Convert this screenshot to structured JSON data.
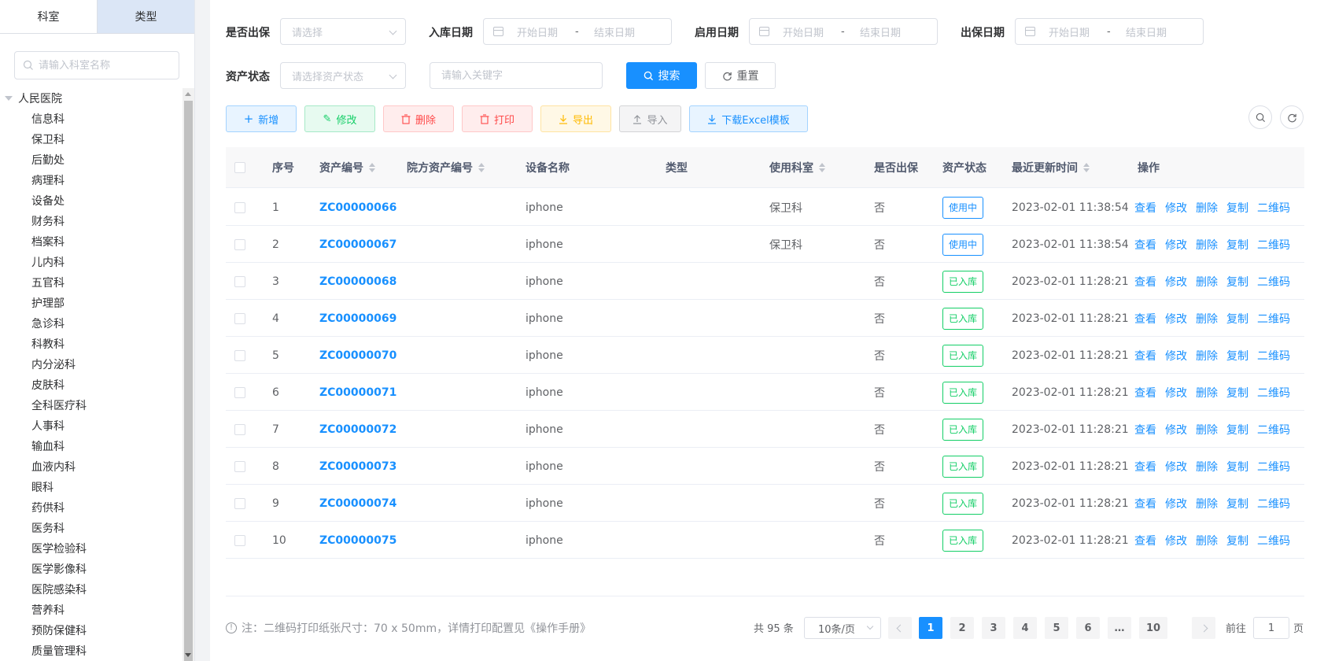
{
  "sidebar": {
    "tabs": [
      {
        "label": "科室"
      },
      {
        "label": "类型"
      }
    ],
    "search_placeholder": "请输入科室名称",
    "tree_root": "人民医院",
    "items": [
      "信息科",
      "保卫科",
      "后勤处",
      "病理科",
      "设备处",
      "财务科",
      "档案科",
      "儿内科",
      "五官科",
      "护理部",
      "急诊科",
      "科教科",
      "内分泌科",
      "皮肤科",
      "全科医疗科",
      "人事科",
      "输血科",
      "血液内科",
      "眼科",
      "药供科",
      "医务科",
      "医学检验科",
      "医学影像科",
      "医院感染科",
      "营养科",
      "预防保健科",
      "质量管理科"
    ]
  },
  "filters": {
    "warranty_label": "是否出保",
    "warranty_placeholder": "请选择",
    "stock_date_label": "入库日期",
    "enable_date_label": "启用日期",
    "out_warranty_date_label": "出保日期",
    "start_placeholder": "开始日期",
    "end_placeholder": "结束日期",
    "dash": "-",
    "status_label": "资产状态",
    "status_placeholder": "请选择资产状态",
    "keyword_placeholder": "请输入关键字",
    "search_btn": "搜索",
    "reset_btn": "重置"
  },
  "toolbar": {
    "add": "新增",
    "edit": "修改",
    "delete": "删除",
    "print": "打印",
    "export": "导出",
    "import": "导入",
    "template": "下载Excel模板"
  },
  "table": {
    "headers": {
      "index": "序号",
      "code": "资产编号",
      "hospital_code": "院方资产编号",
      "device": "设备名称",
      "type": "类型",
      "dept": "使用科室",
      "warranty": "是否出保",
      "status": "资产状态",
      "updated": "最近更新时间",
      "ops": "操作"
    },
    "ops": [
      "查看",
      "修改",
      "删除",
      "复制",
      "二维码"
    ],
    "rows": [
      {
        "index": "1",
        "code": "ZC00000066",
        "device": "iphone",
        "dept": "保卫科",
        "warranty": "否",
        "status": "使用中",
        "status_color": "blue",
        "updated": "2023-02-01 11:38:54"
      },
      {
        "index": "2",
        "code": "ZC00000067",
        "device": "iphone",
        "dept": "保卫科",
        "warranty": "否",
        "status": "使用中",
        "status_color": "blue",
        "updated": "2023-02-01 11:38:54"
      },
      {
        "index": "3",
        "code": "ZC00000068",
        "device": "iphone",
        "dept": "",
        "warranty": "否",
        "status": "已入库",
        "status_color": "green",
        "updated": "2023-02-01 11:28:21"
      },
      {
        "index": "4",
        "code": "ZC00000069",
        "device": "iphone",
        "dept": "",
        "warranty": "否",
        "status": "已入库",
        "status_color": "green",
        "updated": "2023-02-01 11:28:21"
      },
      {
        "index": "5",
        "code": "ZC00000070",
        "device": "iphone",
        "dept": "",
        "warranty": "否",
        "status": "已入库",
        "status_color": "green",
        "updated": "2023-02-01 11:28:21"
      },
      {
        "index": "6",
        "code": "ZC00000071",
        "device": "iphone",
        "dept": "",
        "warranty": "否",
        "status": "已入库",
        "status_color": "green",
        "updated": "2023-02-01 11:28:21"
      },
      {
        "index": "7",
        "code": "ZC00000072",
        "device": "iphone",
        "dept": "",
        "warranty": "否",
        "status": "已入库",
        "status_color": "green",
        "updated": "2023-02-01 11:28:21"
      },
      {
        "index": "8",
        "code": "ZC00000073",
        "device": "iphone",
        "dept": "",
        "warranty": "否",
        "status": "已入库",
        "status_color": "green",
        "updated": "2023-02-01 11:28:21"
      },
      {
        "index": "9",
        "code": "ZC00000074",
        "device": "iphone",
        "dept": "",
        "warranty": "否",
        "status": "已入库",
        "status_color": "green",
        "updated": "2023-02-01 11:28:21"
      },
      {
        "index": "10",
        "code": "ZC00000075",
        "device": "iphone",
        "dept": "",
        "warranty": "否",
        "status": "已入库",
        "status_color": "green",
        "updated": "2023-02-01 11:28:21"
      }
    ]
  },
  "footer": {
    "note": "注：二维码打印纸张尺寸：70 x 50mm，详情打印配置见《操作手册》",
    "total": "共 95 条",
    "page_size": "10条/页",
    "pages": [
      "1",
      "2",
      "3",
      "4",
      "5",
      "6",
      "…",
      "10"
    ],
    "goto_label": "前往",
    "goto_value": "1",
    "page_word": "页"
  },
  "colors": {
    "primary": "#1890ff",
    "success": "#13ce66",
    "danger": "#ff4949",
    "warning": "#ffba00"
  }
}
